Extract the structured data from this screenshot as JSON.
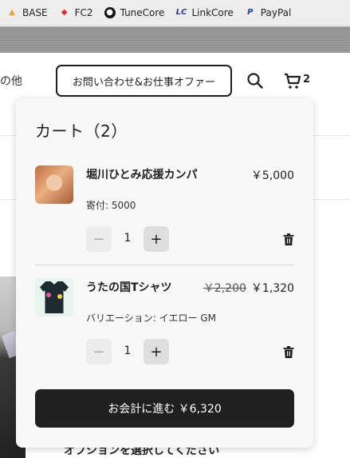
{
  "bookmarks": [
    {
      "label": "BASE",
      "icon": "base-icon"
    },
    {
      "label": "FC2",
      "icon": "fc2-icon"
    },
    {
      "label": "TuneCore",
      "icon": "tunecore-icon"
    },
    {
      "label": "LinkCore",
      "icon": "linkcore-icon"
    },
    {
      "label": "PayPal",
      "icon": "paypal-icon"
    }
  ],
  "header": {
    "nav_partial": "の他",
    "contact_button": "お問い合わせ&お仕事オファー",
    "cart_count": "2"
  },
  "cart": {
    "title": "カート（2）",
    "items": [
      {
        "name": "堀川ひとみ応援カンパ",
        "price": "￥5,000",
        "sub": "寄付: 5000",
        "quantity": "1"
      },
      {
        "name": "うたの国Tシャツ",
        "old_price": "￥2,200",
        "price": "￥1,320",
        "sub": "バリエーション: イエロー GM",
        "quantity": "1"
      }
    ],
    "checkout_label": "お会計に進む ￥6,320"
  },
  "background": {
    "option_text": "オプションを選択してください"
  },
  "colors": {
    "button_dark": "#202020",
    "panel_bg": "#f8f8f8"
  }
}
